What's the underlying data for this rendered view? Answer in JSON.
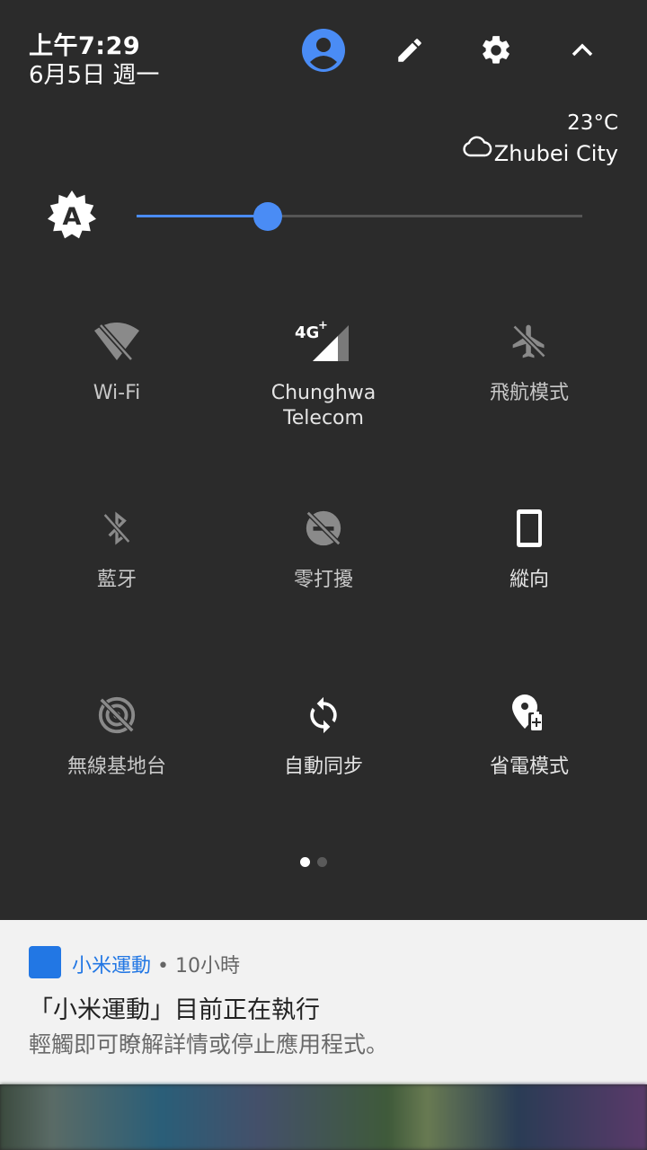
{
  "header": {
    "time": "上午7:29",
    "date": "6月5日 週一"
  },
  "weather": {
    "temperature": "23°C",
    "city": "Zhubei City",
    "icon": "cloud-icon"
  },
  "brightness": {
    "icon": "auto-brightness-icon",
    "level": 0.295
  },
  "tiles": [
    {
      "label": "Wi-Fi",
      "icon": "wifi-off-icon",
      "active": false
    },
    {
      "label": "Chunghwa\nTelecom",
      "icon": "signal-4g-icon",
      "active": true
    },
    {
      "label": "飛航模式",
      "icon": "airplane-icon",
      "active": false
    },
    {
      "label": "藍牙",
      "icon": "bluetooth-off-icon",
      "active": false
    },
    {
      "label": "零打擾",
      "icon": "do-not-disturb-off-icon",
      "active": false
    },
    {
      "label": "縱向",
      "icon": "portrait-orientation-icon",
      "active": true
    },
    {
      "label": "無線基地台",
      "icon": "hotspot-off-icon",
      "active": false
    },
    {
      "label": "自動同步",
      "icon": "sync-icon",
      "active": true
    },
    {
      "label": "省電模式",
      "icon": "battery-saver-icon",
      "active": true
    }
  ],
  "pager": {
    "pages": 2,
    "current": 1
  },
  "notification": {
    "app_name": "小米運動",
    "separator": "•",
    "elapsed": "10小時",
    "title": "「小米運動」目前正在執行",
    "body": "輕觸即可瞭解詳情或停止應用程式。",
    "accent_color": "#2277e4"
  },
  "colors": {
    "panel_bg": "#2b2b2b",
    "accent": "#4a8cf5",
    "inactive_icon": "#8a8a8a"
  }
}
